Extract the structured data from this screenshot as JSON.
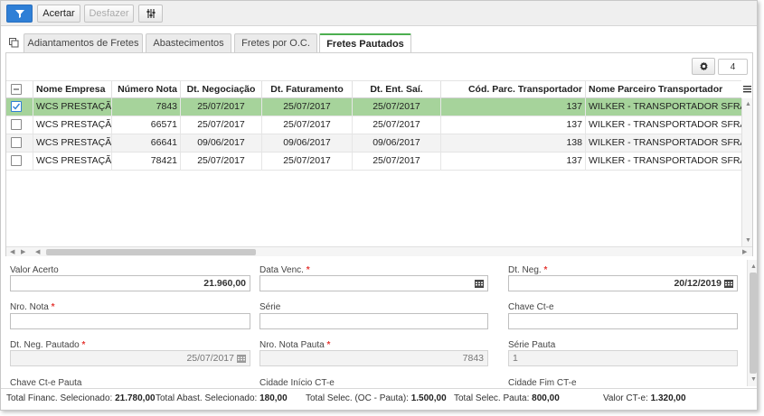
{
  "toolbar": {
    "filter_icon": "filter-icon",
    "acertar_label": "Acertar",
    "desfazer_label": "Desfazer",
    "columns_icon": "column-settings-icon"
  },
  "tabs": [
    {
      "label": "Adiantamentos de Fretes",
      "active": false
    },
    {
      "label": "Abastecimentos",
      "active": false
    },
    {
      "label": "Fretes por O.C.",
      "active": false
    },
    {
      "label": "Fretes Pautados",
      "active": true
    }
  ],
  "grid": {
    "record_count": "4",
    "columns": [
      "Nome Empresa",
      "Número Nota",
      "Dt. Negociação",
      "Dt. Faturamento",
      "Dt. Ent. Saí.",
      "Cód. Parc. Transportador",
      "Nome Parceiro Transportador"
    ],
    "rows": [
      {
        "empresa": "WCS PRESTAÇÃO",
        "nota": "7843",
        "dt_neg": "25/07/2017",
        "dt_fat": "25/07/2017",
        "dt_ent": "25/07/2017",
        "cod_parc": "137",
        "nome_parc": "WILKER - TRANSPORTADOR SFRANGO",
        "checked": true
      },
      {
        "empresa": "WCS PRESTAÇÃO",
        "nota": "66571",
        "dt_neg": "25/07/2017",
        "dt_fat": "25/07/2017",
        "dt_ent": "25/07/2017",
        "cod_parc": "137",
        "nome_parc": "WILKER - TRANSPORTADOR SFRANGO",
        "checked": false
      },
      {
        "empresa": "WCS PRESTAÇÃO",
        "nota": "66641",
        "dt_neg": "09/06/2017",
        "dt_fat": "09/06/2017",
        "dt_ent": "09/06/2017",
        "cod_parc": "138",
        "nome_parc": "WILKER - TRANSPORTADOR SFRANGO",
        "checked": false
      },
      {
        "empresa": "WCS PRESTAÇÃO",
        "nota": "78421",
        "dt_neg": "25/07/2017",
        "dt_fat": "25/07/2017",
        "dt_ent": "25/07/2017",
        "cod_parc": "137",
        "nome_parc": "WILKER - TRANSPORTADOR SFRANGO",
        "checked": false
      }
    ]
  },
  "form": {
    "valor_acerto": {
      "label": "Valor Acerto",
      "value": "21.960,00"
    },
    "data_venc": {
      "label": "Data Venc.",
      "value": ""
    },
    "dt_neg": {
      "label": "Dt. Neg.",
      "value": "20/12/2019"
    },
    "nro_nota": {
      "label": "Nro. Nota",
      "value": ""
    },
    "serie": {
      "label": "Série",
      "value": ""
    },
    "chave_cte": {
      "label": "Chave Ct-e",
      "value": ""
    },
    "dt_neg_pautado": {
      "label": "Dt. Neg. Pautado",
      "value": "25/07/2017"
    },
    "nro_nota_pauta": {
      "label": "Nro. Nota Pauta",
      "value": "7843"
    },
    "serie_pauta": {
      "label": "Série Pauta",
      "value": "1"
    },
    "chave_cte_pauta": {
      "label": "Chave Ct-e Pauta"
    },
    "cidade_inicio": {
      "label": "Cidade Início CT-e"
    },
    "cidade_fim": {
      "label": "Cidade Fim CT-e"
    },
    "required_mark": "*"
  },
  "footer": {
    "total_financ_label": "Total Financ. Selecionado:",
    "total_financ_value": "21.780,00",
    "total_abast_label": "Total Abast. Selecionado:",
    "total_abast_value": "180,00",
    "total_oc_label": "Total Selec. (OC - Pauta):",
    "total_oc_value": "1.500,00",
    "total_pauta_label": "Total Selec. Pauta:",
    "total_pauta_value": "800,00",
    "valor_cte_label": "Valor CT-e:",
    "valor_cte_value": "1.320,00"
  },
  "colors": {
    "accent_blue": "#2f7fd6",
    "selected_row": "#a6d39b",
    "active_tab_border": "#4caf50",
    "required": "#e53935"
  }
}
